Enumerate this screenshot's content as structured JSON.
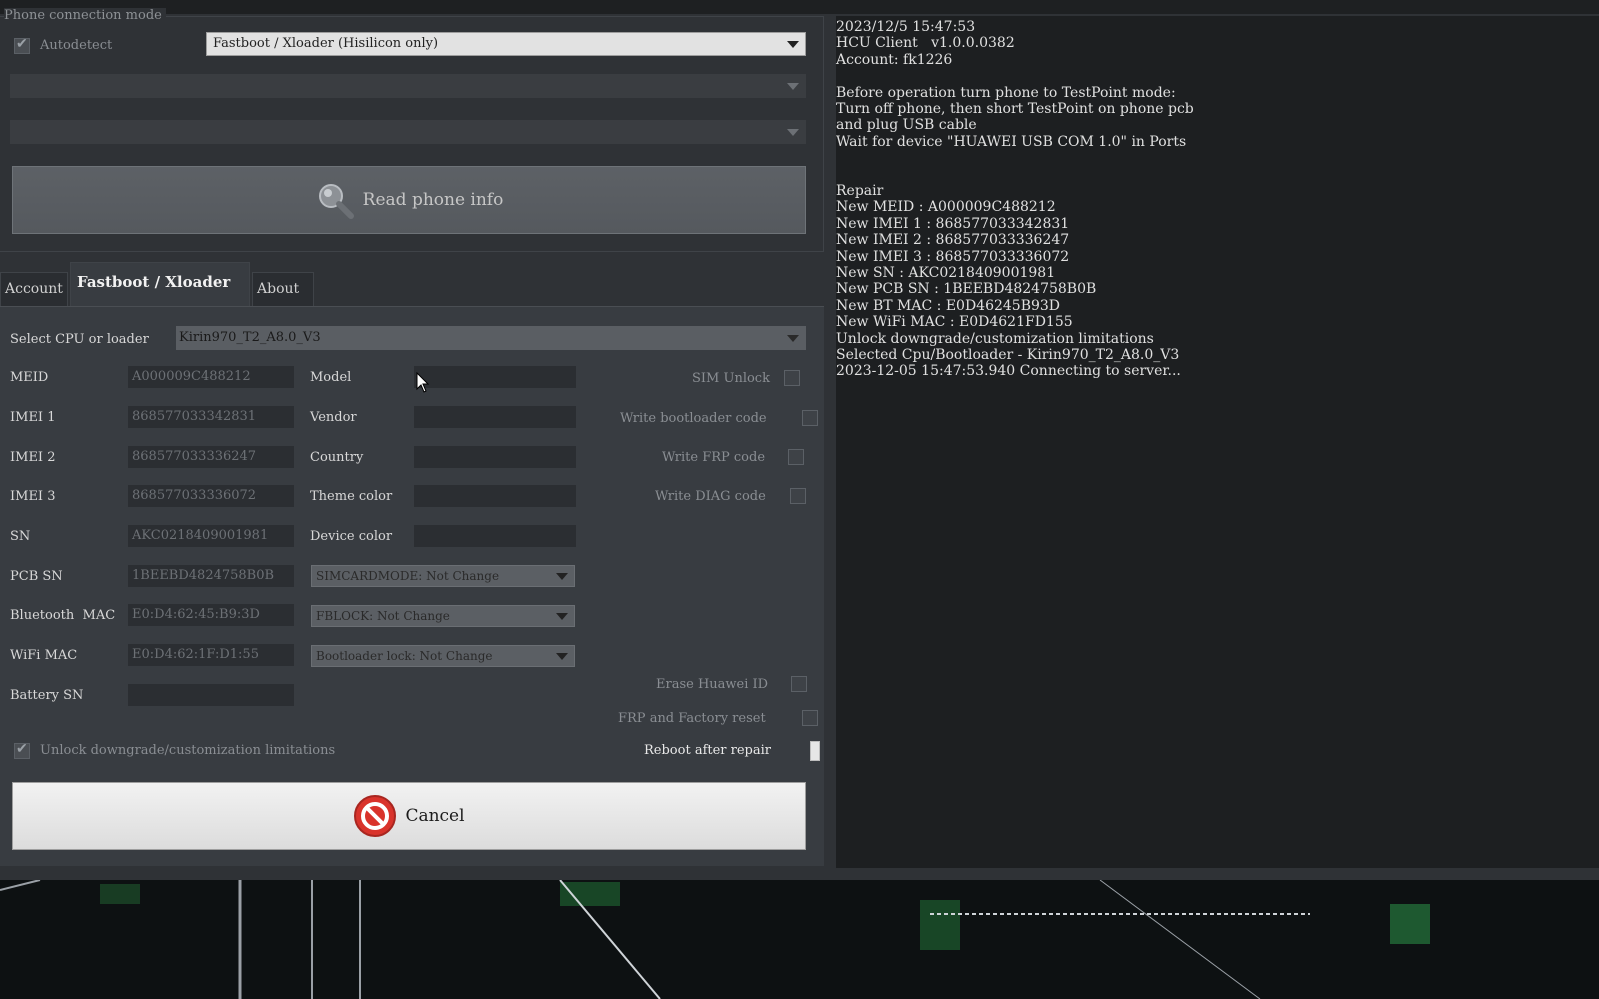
{
  "connection": {
    "group_title": "Phone connection mode",
    "autodetect_label": "Autodetect",
    "autodetect_checked": true,
    "mode_selected": "Fastboot / Xloader (Hisilicon only)",
    "combo2_value": "",
    "combo3_value": "",
    "read_button": "Read phone info"
  },
  "tabs": [
    {
      "label": "Account",
      "active": false
    },
    {
      "label": "Fastboot / Xloader",
      "active": true
    },
    {
      "label": "About",
      "active": false
    }
  ],
  "panel": {
    "cpu_label": "Select CPU or  loader",
    "cpu_selected": "Kirin970_T2_A8.0_V3",
    "fields": [
      {
        "label": "MEID",
        "value": "A000009C488212"
      },
      {
        "label": "IMEI 1",
        "value": "868577033342831"
      },
      {
        "label": "IMEI 2",
        "value": "868577033336247"
      },
      {
        "label": "IMEI 3",
        "value": "868577033336072"
      },
      {
        "label": "SN",
        "value": "AKC0218409001981"
      },
      {
        "label": "PCB SN",
        "value": "1BEEBD4824758B0B"
      },
      {
        "label": "Bluetooth  MAC",
        "value": "E0:D4:62:45:B9:3D"
      },
      {
        "label": "WiFi MAC",
        "value": "E0:D4:62:1F:D1:55"
      },
      {
        "label": "Battery SN",
        "value": ""
      }
    ],
    "info_fields": [
      {
        "label": "Model",
        "value": ""
      },
      {
        "label": "Vendor",
        "value": ""
      },
      {
        "label": "Country",
        "value": ""
      },
      {
        "label": "Theme color",
        "value": ""
      },
      {
        "label": "Device color",
        "value": ""
      }
    ],
    "dropdowns": {
      "simcard": "SIMCARDMODE: Not Change",
      "fblock": "FBLOCK: Not Change",
      "bootloader": "Bootloader lock: Not Change"
    },
    "options": {
      "sim_unlock": "SIM Unlock",
      "write_bootloader": "Write bootloader code",
      "write_frp": "Write FRP code",
      "write_diag": "Write DIAG code",
      "erase_huawei_id": "Erase Huawei ID",
      "frp_factory_reset": "FRP and Factory reset",
      "reboot_after_repair": "Reboot after repair"
    },
    "unlock_downgrade_label": "Unlock downgrade/customization limitations",
    "unlock_downgrade_checked": true,
    "cancel_button": "Cancel"
  },
  "log": {
    "lines": [
      "2023/12/5 15:47:53",
      "HCU Client   v1.0.0.0382",
      "Account: fk1226",
      "",
      "Before operation turn phone to TestPoint mode:",
      "Turn off phone, then short TestPoint on phone pcb",
      "and plug USB cable",
      "Wait for device \"HUAWEI USB COM 1.0\" in Ports",
      "",
      "",
      "Repair",
      "New MEID : A000009C488212",
      "New IMEI 1 : 868577033342831",
      "New IMEI 2 : 868577033336247",
      "New IMEI 3 : 868577033336072",
      "New SN : AKC0218409001981",
      "New PCB SN : 1BEEBD4824758B0B",
      "New BT MAC : E0D46245B93D",
      "New WiFi MAC : E0D4621FD155",
      "Unlock downgrade/customization limitations",
      "Selected Cpu/Bootloader - Kirin970_T2_A8.0_V3",
      "2023-12-05 15:47:53.940 Connecting to server..."
    ]
  },
  "colors": {
    "window_bg": "#2f3236",
    "panel_bg": "#383c41",
    "log_bg": "#1d1f21",
    "cancel_icon": "#d9332b"
  }
}
